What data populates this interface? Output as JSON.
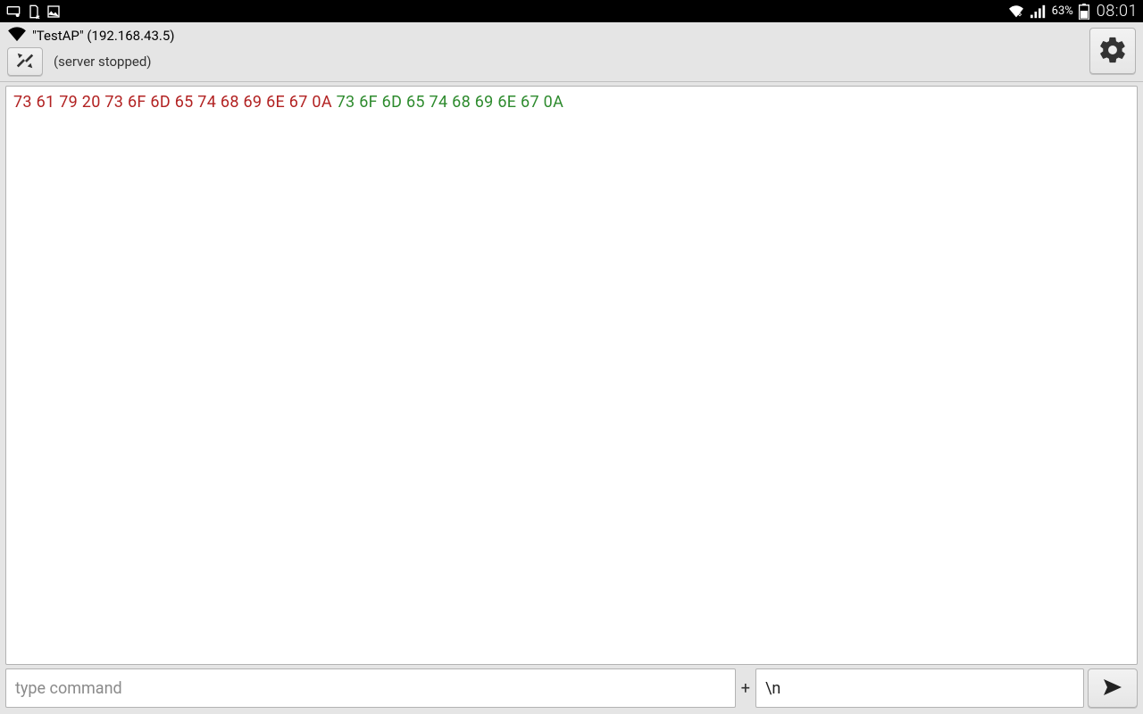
{
  "statusbar": {
    "battery_pct": "63%",
    "time": "08:01"
  },
  "header": {
    "ap_label": "\"TestAP\" (192.168.43.5)",
    "server_state": "(server stopped)"
  },
  "output": {
    "hex_out": "73 61 79 20 73 6F 6D 65 74 68 69 6E 67 0A",
    "hex_in": "73 6F 6D 65 74 68 69 6E 67 0A"
  },
  "input": {
    "command_placeholder": "type command",
    "command_value": "",
    "plus": "+",
    "eol_value": "\\n"
  }
}
